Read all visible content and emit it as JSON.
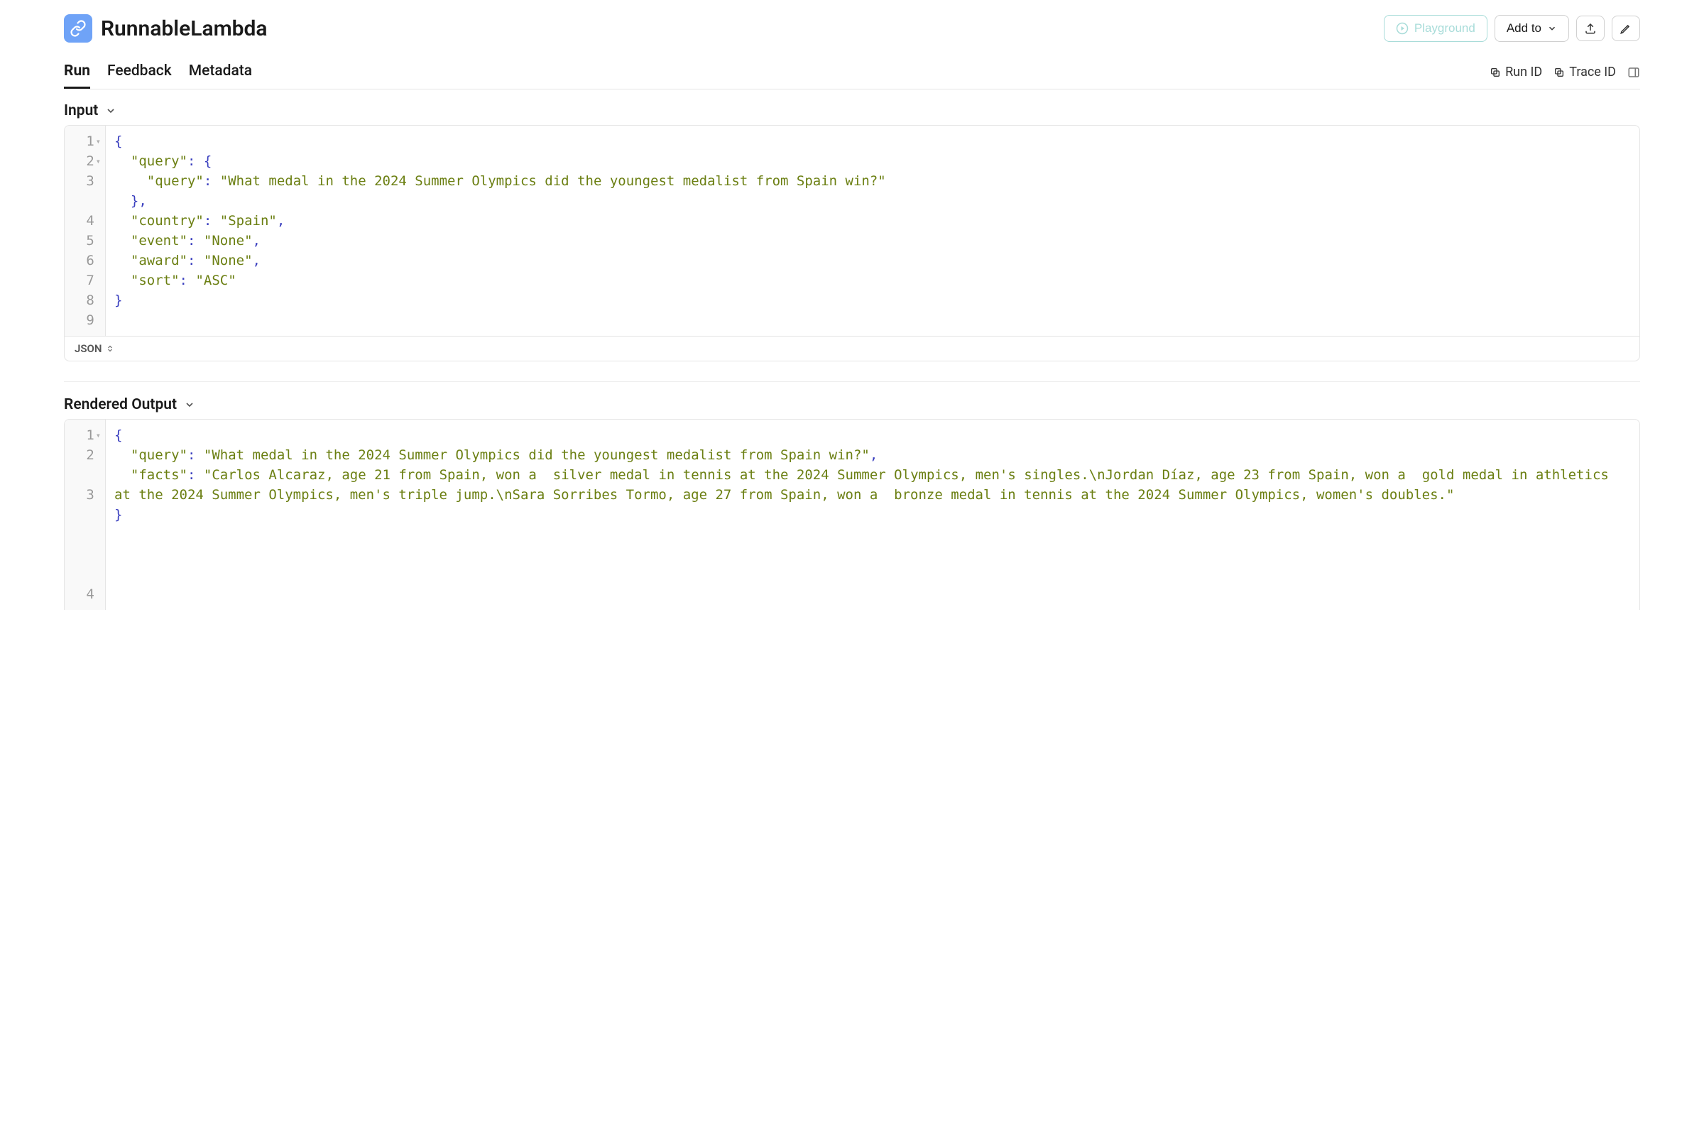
{
  "header": {
    "title": "RunnableLambda",
    "buttons": {
      "playground": "Playground",
      "add_to": "Add to"
    }
  },
  "tabs": {
    "run": "Run",
    "feedback": "Feedback",
    "metadata": "Metadata"
  },
  "ids": {
    "run_id": "Run ID",
    "trace_id": "Trace ID"
  },
  "sections": {
    "input": "Input",
    "rendered_output": "Rendered Output"
  },
  "code_footer_label": "JSON",
  "input_block": {
    "lines": [
      1,
      2,
      3,
      4,
      5,
      6,
      7,
      8,
      9
    ],
    "json": {
      "l3_key1": "\"query\"",
      "l3_key2": "\"query\"",
      "l3_str": "\"What medal in the 2024 Summer Olympics did the youngest medalist from Spain win?\"",
      "l5_key": "\"country\"",
      "l5_val": "\"Spain\"",
      "l6_key": "\"event\"",
      "l6_val": "\"None\"",
      "l7_key": "\"award\"",
      "l7_val": "\"None\"",
      "l8_key": "\"sort\"",
      "l8_val": "\"ASC\""
    }
  },
  "output_block": {
    "lines": [
      1,
      2,
      3,
      4
    ],
    "json": {
      "l2_key": "\"query\"",
      "l2_val": "\"What medal in the 2024 Summer Olympics did the youngest medalist from Spain win?\"",
      "l3_key": "\"facts\"",
      "l3_val": "\"Carlos Alcaraz, age 21 from Spain, won a  silver medal in tennis at the 2024 Summer Olympics, men's singles.\\nJordan Díaz, age 23 from Spain, won a  gold medal in athletics at the 2024 Summer Olympics, men's triple jump.\\nSara Sorribes Tormo, age 27 from Spain, won a  bronze medal in tennis at the 2024 Summer Olympics, women's doubles.\""
    }
  }
}
